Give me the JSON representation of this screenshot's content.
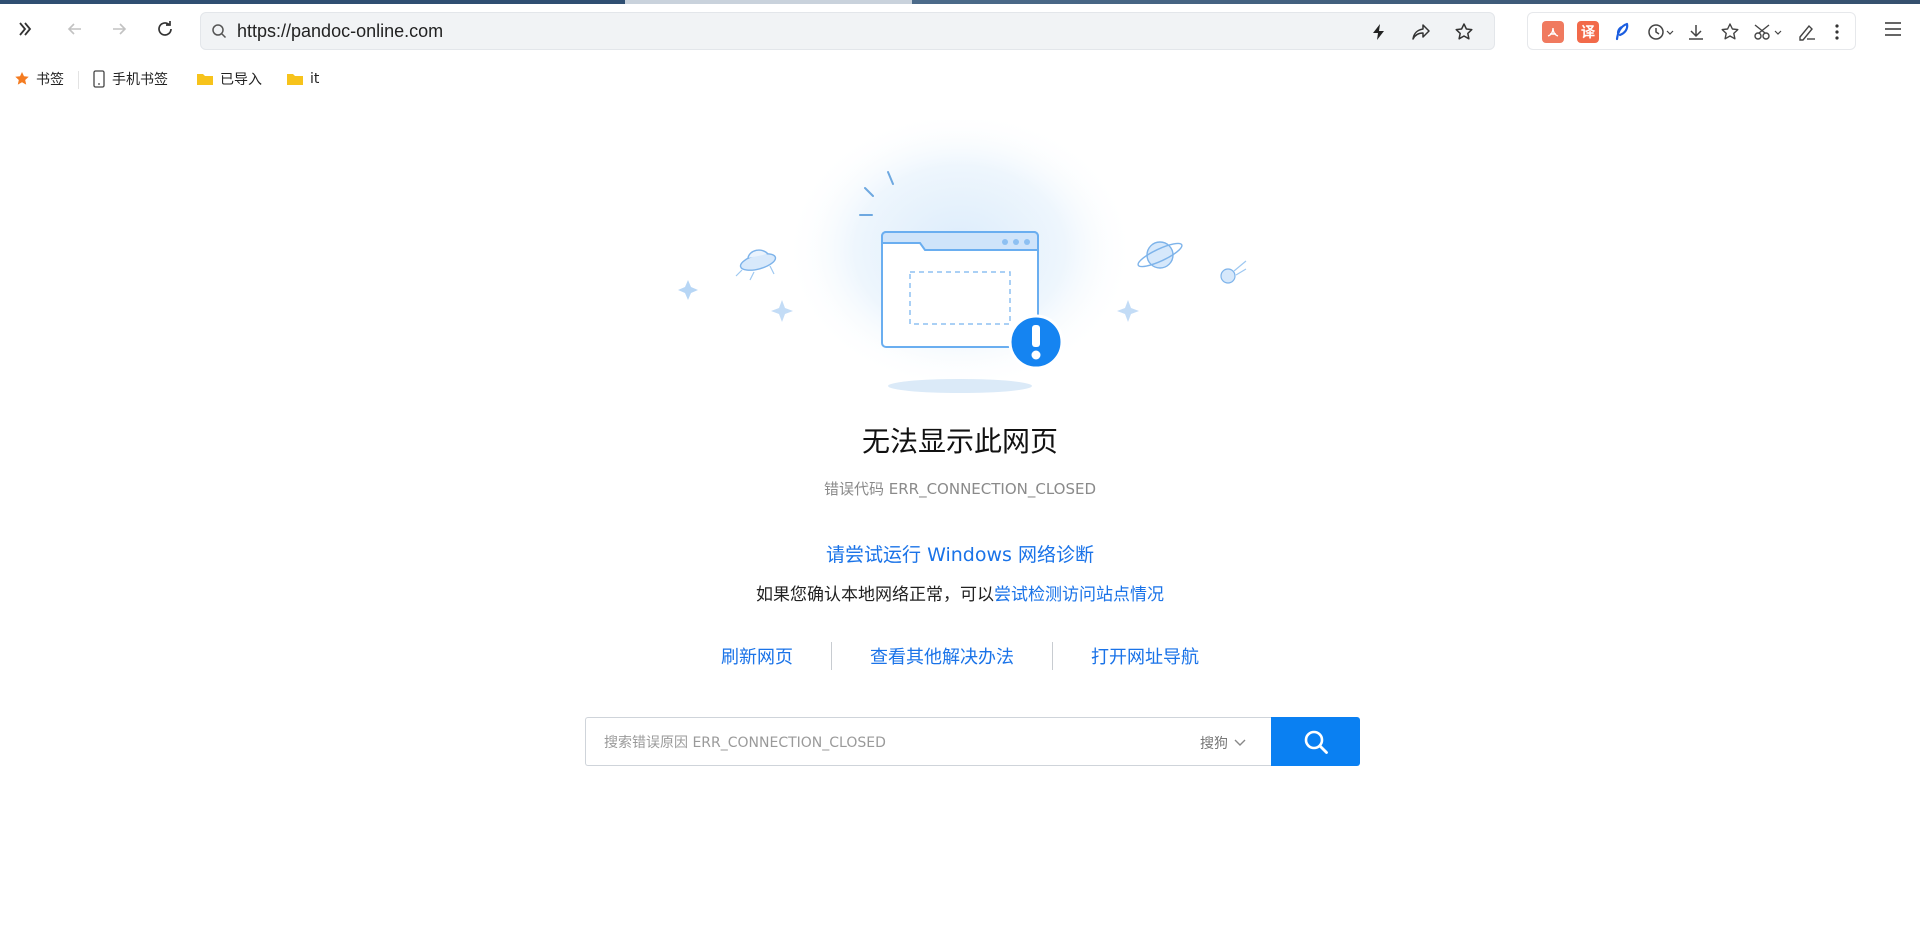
{
  "browser": {
    "url": "https://pandoc-online.com",
    "extensions": [
      "pdf-icon",
      "translate-icon",
      "feather-icon",
      "history-icon",
      "download-icon",
      "favorites-icon",
      "scissors-icon",
      "sign-icon",
      "more-icon"
    ],
    "extension_labels": {
      "translate": "译"
    },
    "bookmarks": [
      {
        "label": "书签",
        "icon": "star-icon"
      },
      {
        "label": "手机书签",
        "icon": "phone-icon"
      },
      {
        "label": "已导入",
        "icon": "folder-icon"
      },
      {
        "label": "it",
        "icon": "folder-icon"
      }
    ]
  },
  "error_page": {
    "title": "无法显示此网页",
    "error_code": "错误代码 ERR_CONNECTION_CLOSED",
    "try_windows_link": "请尝试运行 Windows 网络诊断",
    "confirm_text": "如果您确认本地网络正常，可以",
    "confirm_link": "尝试检测访问站点情况",
    "actions": [
      "刷新网页",
      "查看其他解决办法",
      "打开网址导航"
    ],
    "search": {
      "placeholder": "搜索错误原因 ERR_CONNECTION_CLOSED",
      "engine": "搜狗"
    }
  },
  "colors": {
    "link": "#1a73e8",
    "search_button": "#0a80f2",
    "alert": "#1584f1"
  }
}
